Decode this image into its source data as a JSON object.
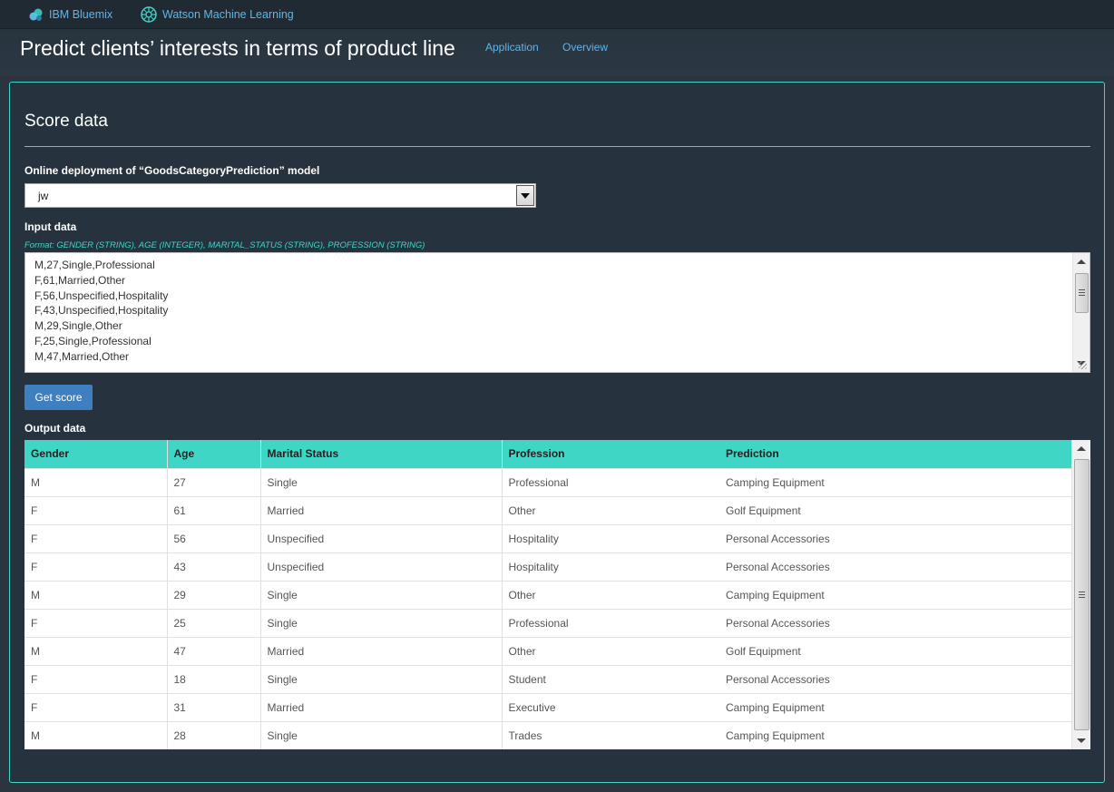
{
  "topnav": {
    "bluemix_label": "IBM Bluemix",
    "watson_label": "Watson Machine Learning"
  },
  "header": {
    "title": "Predict clients’ interests in terms of product line",
    "links": [
      "Application",
      "Overview"
    ]
  },
  "panel": {
    "title": "Score data",
    "deployment_label": "Online deployment of “GoodsCategoryPrediction” model",
    "deployment_value": "jw",
    "input_label": "Input data",
    "input_format": "Format: GENDER (STRING), AGE (INTEGER), MARITAL_STATUS (STRING), PROFESSION (STRING)",
    "input_lines": [
      "M,27,Single,Professional",
      "F,61,Married,Other",
      "F,56,Unspecified,Hospitality",
      "F,43,Unspecified,Hospitality",
      "M,29,Single,Other",
      "F,25,Single,Professional",
      "M,47,Married,Other"
    ],
    "score_button": "Get score",
    "output_label": "Output data"
  },
  "table": {
    "headers": [
      "Gender",
      "Age",
      "Marital Status",
      "Profession",
      "Prediction"
    ],
    "rows": [
      [
        "M",
        "27",
        "Single",
        "Professional",
        "Camping Equipment"
      ],
      [
        "F",
        "61",
        "Married",
        "Other",
        "Golf Equipment"
      ],
      [
        "F",
        "56",
        "Unspecified",
        "Hospitality",
        "Personal Accessories"
      ],
      [
        "F",
        "43",
        "Unspecified",
        "Hospitality",
        "Personal Accessories"
      ],
      [
        "M",
        "29",
        "Single",
        "Other",
        "Camping Equipment"
      ],
      [
        "F",
        "25",
        "Single",
        "Professional",
        "Personal Accessories"
      ],
      [
        "M",
        "47",
        "Married",
        "Other",
        "Golf Equipment"
      ],
      [
        "F",
        "18",
        "Single",
        "Student",
        "Personal Accessories"
      ],
      [
        "F",
        "31",
        "Married",
        "Executive",
        "Camping Equipment"
      ],
      [
        "M",
        "28",
        "Single",
        "Trades",
        "Camping Equipment"
      ]
    ]
  },
  "colors": {
    "accent": "#3fd6c6",
    "link": "#5fb6e8",
    "button": "#3f7fbf",
    "background": "#2a3540"
  },
  "icons": {
    "bluemix": "bluemix-logo-icon",
    "watson": "watson-logo-icon"
  }
}
